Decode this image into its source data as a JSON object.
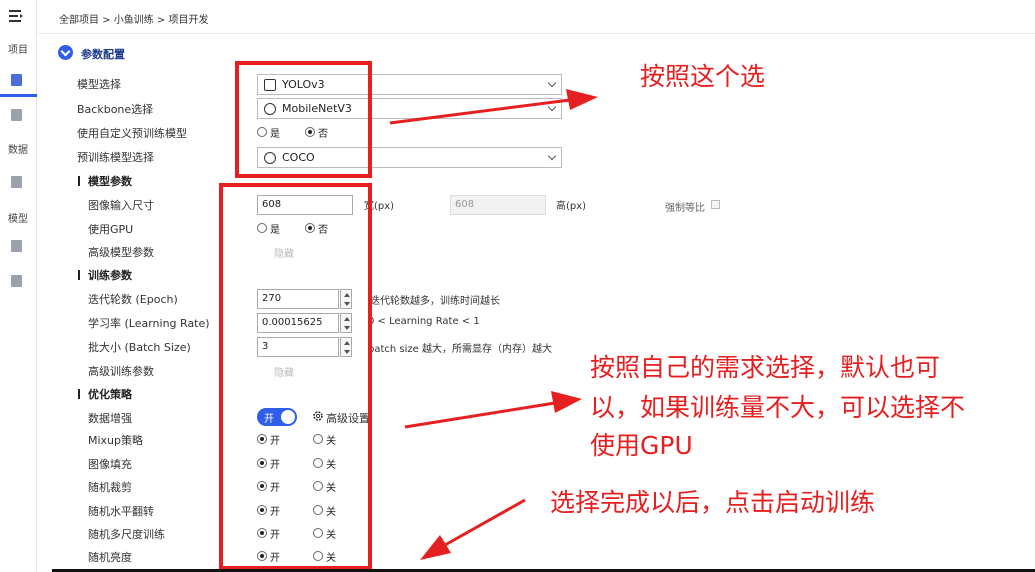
{
  "nav": {
    "items": [
      {
        "label": "项目"
      },
      {
        "label": "数据"
      },
      {
        "label": "模型"
      }
    ]
  },
  "breadcrumb": "全部项目 > 小鱼训练 > 项目开发",
  "section": {
    "title": "参数配置"
  },
  "form": {
    "model_select": {
      "label": "模型选择",
      "value": "YOLOv3"
    },
    "backbone": {
      "label": "Backbone选择",
      "value": "MobileNetV3"
    },
    "custom_pretrain": {
      "label": "使用自定义预训练模型",
      "opt_yes": "是",
      "opt_no": "否",
      "selected": "否"
    },
    "pretrain_select": {
      "label": "预训练模型选择",
      "value": "COCO"
    }
  },
  "model_params": {
    "heading": "模型参数",
    "image_size": {
      "label": "图像输入尺寸",
      "width": "608",
      "width_unit": "宽(px)",
      "height": "608",
      "height_unit": "高(px)",
      "keep_ratio": "强制等比"
    },
    "use_gpu": {
      "label": "使用GPU",
      "opt_yes": "是",
      "opt_no": "否",
      "selected": "否"
    },
    "advanced": {
      "label": "高级模型参数",
      "button": "隐藏"
    }
  },
  "train_params": {
    "heading": "训练参数",
    "epoch": {
      "label": "迭代轮数 (Epoch)",
      "value": "270",
      "hint": "迭代轮数越多，训练时间越长"
    },
    "lr": {
      "label": "学习率 (Learning Rate)",
      "value": "0.00015625",
      "hint": "0 < Learning Rate < 1"
    },
    "batch": {
      "label": "批大小 (Batch Size)",
      "value": "3",
      "hint": "batch size 越大，所需显存（内存）越大"
    },
    "advanced": {
      "label": "高级训练参数",
      "button": "隐藏"
    }
  },
  "optim": {
    "heading": "优化策略",
    "augment": {
      "label": "数据增强",
      "toggle": "开",
      "settings": "高级设置"
    },
    "rows": [
      {
        "label": "Mixup策略",
        "on": "开",
        "off": "关"
      },
      {
        "label": "图像填充",
        "on": "开",
        "off": "关"
      },
      {
        "label": "随机裁剪",
        "on": "开",
        "off": "关"
      },
      {
        "label": "随机水平翻转",
        "on": "开",
        "off": "关"
      },
      {
        "label": "随机多尺度训练",
        "on": "开",
        "off": "关"
      },
      {
        "label": "随机亮度",
        "on": "开",
        "off": "关"
      }
    ]
  },
  "annotations": {
    "a1": "按照这个选",
    "a2_line1": "按照自己的需求选择，默认也可",
    "a2_line2": "以，如果训练量不大，可以选择不",
    "a2_line3": "使用GPU",
    "a3": "选择完成以后，点击启动训练"
  },
  "colors": {
    "accent": "#2f5ee8",
    "annotation_red": "#e62020"
  }
}
